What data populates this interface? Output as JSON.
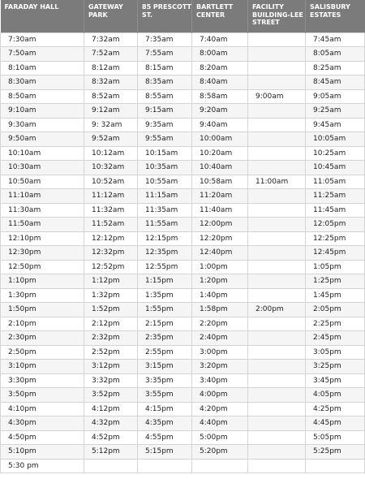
{
  "columns": [
    "FARADAY HALL",
    "GATEWAY PARK",
    "85 PRESCOTT ST.",
    "BARTLETT CENTER",
    "FACILITY BUILDING-LEE STREET",
    "SALISBURY ESTATES"
  ],
  "rows": [
    [
      "7:30am",
      "7:32am",
      "7:35am",
      "7:40am",
      "",
      "7:45am"
    ],
    [
      "7:50am",
      "7:52am",
      "7:55am",
      "8:00am",
      "",
      "8:05am"
    ],
    [
      "8:10am",
      "8:12am",
      "8:15am",
      "8:20am",
      "",
      "8:25am"
    ],
    [
      "8:30am",
      "8:32am",
      "8:35am",
      "8:40am",
      "",
      "8:45am"
    ],
    [
      "8:50am",
      "8:52am",
      "8:55am",
      "8:58am",
      "9:00am",
      "9:05am"
    ],
    [
      "9:10am",
      "9:12am",
      "9:15am",
      "9:20am",
      "",
      "9:25am"
    ],
    [
      "9:30am",
      "9: 32am",
      "9:35am",
      "9:40am",
      "",
      "9:45am"
    ],
    [
      "9:50am",
      "9:52am",
      "9:55am",
      "10:00am",
      "",
      "10:05am"
    ],
    [
      "10:10am",
      "10:12am",
      "10:15am",
      "10:20am",
      "",
      "10:25am"
    ],
    [
      "10:30am",
      "10:32am",
      "10:35am",
      "10:40am",
      "",
      "10:45am"
    ],
    [
      "10:50am",
      "10:52am",
      "10:55am",
      "10:58am",
      "11:00am",
      "11:05am"
    ],
    [
      "11:10am",
      "11:12am",
      "11:15am",
      "11:20am",
      "",
      "11:25am"
    ],
    [
      "11:30am",
      "11:32am",
      "11:35am",
      "11:40am",
      "",
      "11:45am"
    ],
    [
      "11:50am",
      "11:52am",
      "11:55am",
      "12:00pm",
      "",
      "12:05pm"
    ],
    [
      "12:10pm",
      "12:12pm",
      "12:15pm",
      "12:20pm",
      "",
      "12:25pm"
    ],
    [
      "12:30pm",
      "12:32pm",
      "12:35pm",
      "12:40pm",
      "",
      "12:45pm"
    ],
    [
      "12:50pm",
      "12:52pm",
      "12:55pm",
      "1:00pm",
      "",
      "1:05pm"
    ],
    [
      "1:10pm",
      "1:12pm",
      "1:15pm",
      "1:20pm",
      "",
      "1:25pm"
    ],
    [
      "1:30pm",
      "1:32pm",
      "1:35pm",
      "1:40pm",
      "",
      "1:45pm"
    ],
    [
      "1:50pm",
      "1:52pm",
      "1:55pm",
      "1:58pm",
      "2:00pm",
      "2:05pm"
    ],
    [
      "2:10pm",
      "2:12pm",
      "2:15pm",
      "2:20pm",
      "",
      "2:25pm"
    ],
    [
      "2:30pm",
      "2:32pm",
      "2:35pm",
      "2:40pm",
      "",
      "2:45pm"
    ],
    [
      "2:50pm",
      "2:52pm",
      "2:55pm",
      "3:00pm",
      "",
      "3:05pm"
    ],
    [
      "3:10pm",
      "3:12pm",
      "3:15pm",
      "3:20pm",
      "",
      "3:25pm"
    ],
    [
      "3:30pm",
      "3:32pm",
      "3:35pm",
      "3:40pm",
      "",
      "3:45pm"
    ],
    [
      "3:50pm",
      "3:52pm",
      "3:55pm",
      "4:00pm",
      "",
      "4:05pm"
    ],
    [
      "4:10pm",
      "4:12pm",
      "4:15pm",
      "4:20pm",
      "",
      "4:25pm"
    ],
    [
      "4:30pm",
      "4:32pm",
      "4:35pm",
      "4:40pm",
      "",
      "4:45pm"
    ],
    [
      "4:50pm",
      "4:52pm",
      "4:55pm",
      "5:00pm",
      "",
      "5:05pm"
    ],
    [
      "5:10pm",
      "5:12pm",
      "5:15pm",
      "5:20pm",
      "",
      "5:25pm"
    ],
    [
      "5:30 pm",
      "",
      "",
      "",
      "",
      ""
    ]
  ]
}
